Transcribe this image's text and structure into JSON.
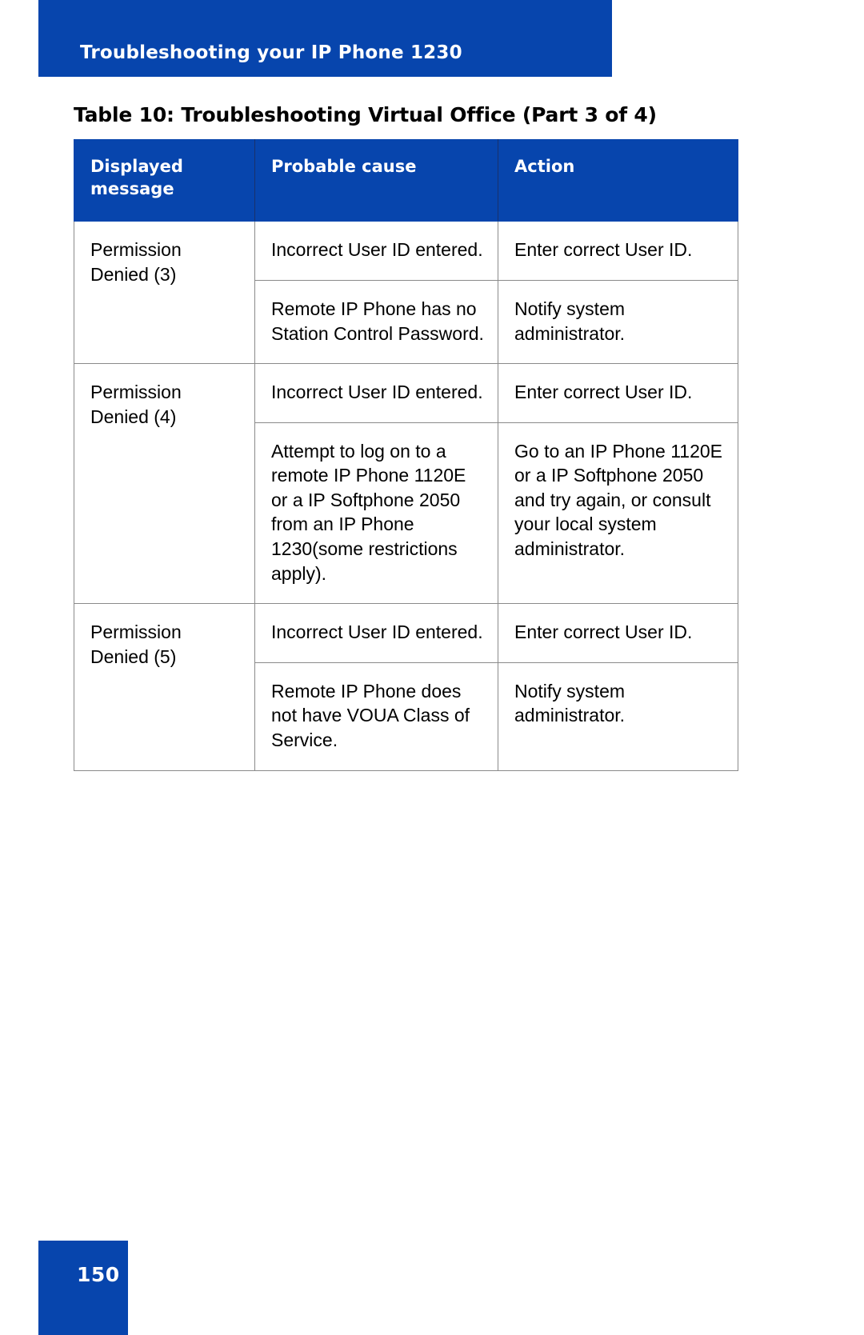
{
  "header": {
    "running_title": "Troubleshooting your IP Phone 1230",
    "bar_color": "#0745AD"
  },
  "caption": "Table 10: Troubleshooting Virtual Office (Part 3 of 4)",
  "table": {
    "columns": [
      "Displayed message",
      "Probable cause",
      "Action"
    ],
    "rows": [
      {
        "message": "Permission Denied (3)",
        "entries": [
          {
            "cause": "Incorrect User ID entered.",
            "action": "Enter correct User ID."
          },
          {
            "cause": "Remote IP Phone has no Station Control Password.",
            "action": "Notify system administrator."
          }
        ]
      },
      {
        "message": "Permission Denied (4)",
        "entries": [
          {
            "cause": "Incorrect User ID entered.",
            "action": "Enter correct User ID."
          },
          {
            "cause": "Attempt to log on to a remote IP Phone 1120E or a IP Softphone 2050 from an IP Phone 1230(some restrictions apply).",
            "action": "Go to an IP Phone 1120E or a IP Softphone 2050 and try again, or consult your local system administrator."
          }
        ]
      },
      {
        "message": "Permission Denied (5)",
        "entries": [
          {
            "cause": "Incorrect User ID entered.",
            "action": "Enter correct User ID."
          },
          {
            "cause": "Remote IP Phone does not have VOUA Class of Service.",
            "action": "Notify system administrator."
          }
        ]
      }
    ]
  },
  "footer": {
    "page_number": "150",
    "block_color": "#0745AD"
  }
}
